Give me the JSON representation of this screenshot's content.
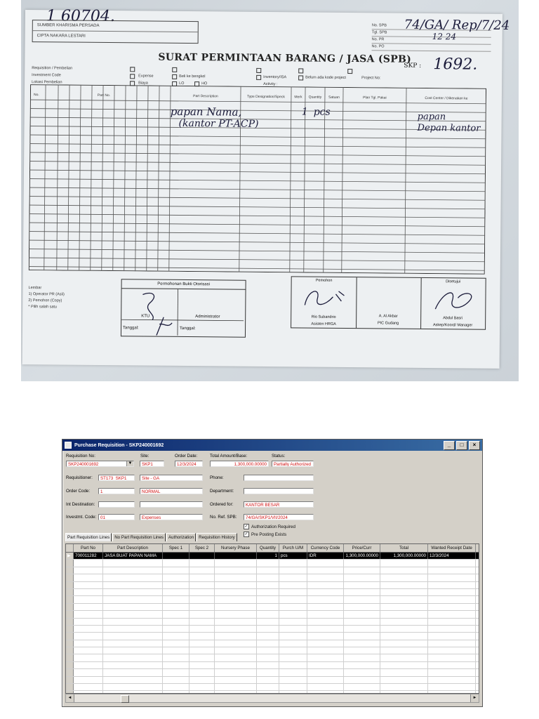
{
  "paper": {
    "ghost_top": "1 60704.",
    "company_lines": [
      "SUMBER KHARISMA PERSADA",
      "CIPTA NAKARA LESTARI"
    ],
    "meta_labels": [
      "No. SPB",
      "Tgl. SPB",
      "No. PR",
      "No. PO"
    ],
    "hw_spb": "74/GA/ Rep/7/24",
    "hw_tgl": "12 24",
    "title": "SURAT PERMINTAAN BARANG / JASA (SPB)",
    "skp_label": "SKP :",
    "hw_skp": "1692.",
    "opt_rows": [
      [
        "Requisition / Pembelian",
        "Expense",
        "Beli ke bengkel",
        "Inventory/ISA",
        "Belum ada kode project",
        "Project No:"
      ],
      [
        "Investment Code",
        "Biaya",
        "LO",
        "HO",
        "Activity :",
        ""
      ],
      [
        "Lokasi Pembelian",
        "",
        "",
        "",
        "",
        ""
      ]
    ],
    "grid_headers": [
      "No.",
      "Part No.",
      "Part Description",
      "Type Designation/Speck",
      "Merk",
      "Quantity",
      "Satuan",
      "Plan Tgl. Pakai",
      "Cost Center / Dikenakan ke"
    ],
    "hw_item1": "papan Nama,",
    "hw_item2": "(kantor PT-ACP)",
    "hw_qty": "1",
    "hw_unit": "pcs",
    "hw_note1": "papan",
    "hw_note2": "Depan kantor",
    "lembar": [
      "Lembar",
      "1) Operator PR (Asli)",
      "2) Pemohon (Copy)",
      "* Pilih salah satu"
    ],
    "approve_title": "Permohonan Bukti Otorisasi",
    "approve_left": "KTU",
    "approve_right": "Administrator",
    "approve_date_l": "Tanggal:",
    "approve_date_r": "Tanggal:",
    "sign_cols": [
      "Pemohon",
      "",
      "Disetujui"
    ],
    "sign_names": [
      "Rio Subandrio",
      "A. Al Akbar",
      "Abdul Basri"
    ],
    "sign_roles": [
      "Asisten HRGA",
      "PIC Gudang",
      "Askep/Koord/ Manager"
    ]
  },
  "window": {
    "title": "Purchase Requisition - SKP240001692",
    "labels": {
      "req_no": "Requisition No:",
      "site": "Site:",
      "order_date": "Order Date:",
      "total": "Total Amount/Base:",
      "status": "Status:",
      "requisitioner": "Requisitioner:",
      "phone": "Phone:",
      "order_code": "Order Code:",
      "department": "Department:",
      "int_dest": "Int Destination:",
      "ordered_for": "Ordered for:",
      "invest_code": "Investmt. Code:",
      "no_ref": "No. Ref. SPB:"
    },
    "values": {
      "req_no": "SKP240001692",
      "site": "SKP1",
      "order_date": "12/3/2024",
      "total": "1,300,000.00000",
      "status": "Partially Authorized",
      "requisitioner_id": "ST173_SKP1",
      "requisitioner_name": "Site - GA",
      "phone": "",
      "order_code": "1",
      "order_code_name": "NORMAL",
      "department": "",
      "int_dest": "",
      "int_dest_name": "",
      "ordered_for": "KANTOR BESAR",
      "invest_code": "01",
      "invest_name": "Expenses",
      "no_ref": "74/GA/SKP1/VII/2024"
    },
    "checks": {
      "auth_required": "Authorization Required",
      "pre_posting": "Pre Posting Exists"
    },
    "tabs": [
      "Part Requisition Lines",
      "No Part Requisition Lines",
      "Authorization",
      "Requisition History"
    ],
    "columns": [
      "Part No",
      "Part Description",
      "Spec 1",
      "Spec 2",
      "Nursery Phase",
      "Quantity",
      "Purch U/M",
      "Currency Code",
      "Price/Curr",
      "Total",
      "Wanted Receipt Date"
    ],
    "rows": [
      [
        "700011282",
        "JASA BUAT PAPAN NAMA",
        "",
        "",
        "",
        "1",
        "pcs",
        "IDR",
        "1,300,000.00000",
        "1,300,000.00000",
        "12/3/2024"
      ]
    ]
  }
}
